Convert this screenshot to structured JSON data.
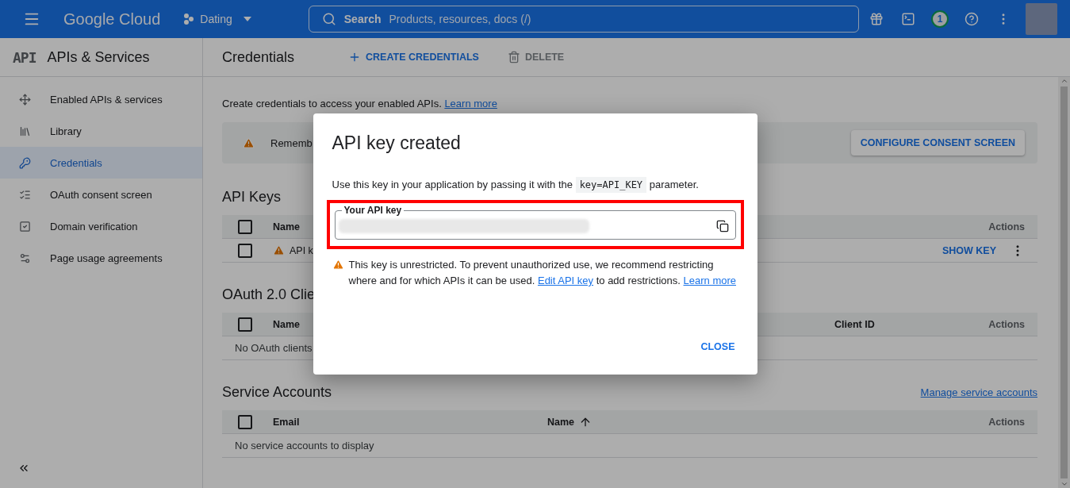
{
  "top_bar": {
    "logo": "Google Cloud",
    "project": "Dating",
    "search": {
      "label": "Search",
      "placeholder": "Products, resources, docs (/)"
    },
    "notification_count": "1"
  },
  "sidebar": {
    "logo": "API",
    "title": "APIs & Services",
    "items": [
      {
        "label": "Enabled APIs & services",
        "selected": false
      },
      {
        "label": "Library",
        "selected": false
      },
      {
        "label": "Credentials",
        "selected": true
      },
      {
        "label": "OAuth consent screen",
        "selected": false
      },
      {
        "label": "Domain verification",
        "selected": false
      },
      {
        "label": "Page usage agreements",
        "selected": false
      }
    ]
  },
  "header": {
    "title": "Credentials",
    "actions": [
      {
        "label": "CREATE CREDENTIALS",
        "disabled": false
      },
      {
        "label": "DELETE",
        "disabled": true
      }
    ]
  },
  "intro": {
    "text": "Create credentials to access your enabled APIs.",
    "link": "Learn more"
  },
  "notice": {
    "text": "Rememb",
    "button": "CONFIGURE CONSENT SCREEN"
  },
  "sections": [
    {
      "kind": "api_keys",
      "title": "API Keys",
      "all_checked": false,
      "columns": [
        {
          "label": "Name"
        },
        {
          "label": "Actions"
        }
      ],
      "rows": [
        {
          "name": "API k",
          "checked": false,
          "warning": true,
          "action": "SHOW KEY"
        }
      ]
    },
    {
      "kind": "oauth",
      "title": "OAuth 2.0 Clie",
      "all_checked": false,
      "columns": [
        {
          "label": "Name"
        },
        {
          "label": "Client ID"
        },
        {
          "label": "Actions"
        }
      ],
      "empty": "No OAuth clients"
    },
    {
      "kind": "service_accounts",
      "title": "Service Accounts",
      "link": "Manage service accounts",
      "all_checked": false,
      "columns": [
        {
          "label": "Email"
        },
        {
          "label": "Name",
          "sorted_ascending": true
        },
        {
          "label": "Actions"
        }
      ],
      "empty": "No service accounts to display"
    }
  ],
  "dialog": {
    "title": "API key created",
    "description": {
      "before": "Use this key in your application by passing it with the",
      "code": "key=API_KEY",
      "after": "parameter."
    },
    "field": {
      "label": "Your API key",
      "highlighted": true
    },
    "warning": [
      {
        "kind": "text",
        "text": "This key is unrestricted. To prevent unauthorized use, we recommend restricting where and for which APIs it can be used. "
      },
      {
        "kind": "link",
        "text": "Edit API key"
      },
      {
        "kind": "text",
        "text": " to add restrictions. "
      },
      {
        "kind": "link",
        "text": "Learn more"
      }
    ],
    "button": "CLOSE"
  }
}
